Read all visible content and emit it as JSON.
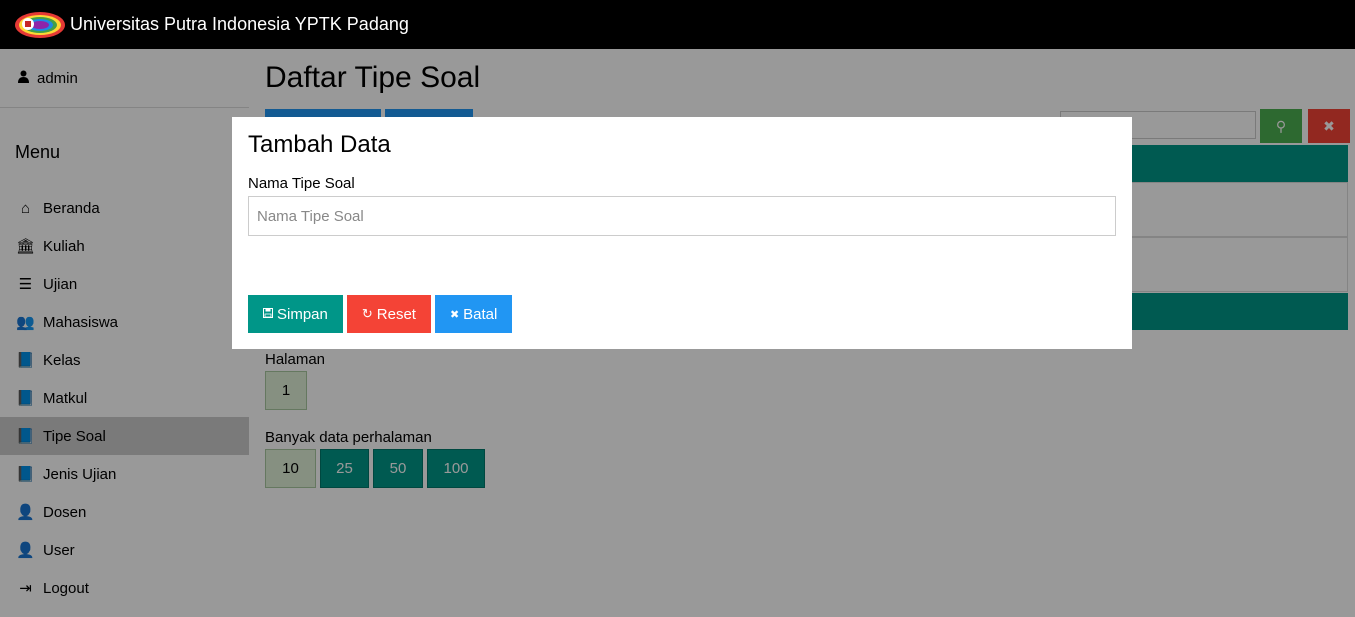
{
  "header": {
    "brand": "Universitas Putra Indonesia YPTK Padang"
  },
  "sidebar": {
    "user": "admin",
    "menu_title": "Menu",
    "items": [
      {
        "label": "Beranda",
        "icon": "home-icon",
        "glyph": "⌂"
      },
      {
        "label": "Kuliah",
        "icon": "institution-icon",
        "glyph": "🏛"
      },
      {
        "label": "Ujian",
        "icon": "list-alt-icon",
        "glyph": "☰"
      },
      {
        "label": "Mahasiswa",
        "icon": "users-icon",
        "glyph": "👥"
      },
      {
        "label": "Kelas",
        "icon": "book-icon",
        "glyph": "📘"
      },
      {
        "label": "Matkul",
        "icon": "book-icon",
        "glyph": "📘"
      },
      {
        "label": "Tipe Soal",
        "icon": "book-icon",
        "glyph": "📘"
      },
      {
        "label": "Jenis Ujian",
        "icon": "book-icon",
        "glyph": "📘"
      },
      {
        "label": "Dosen",
        "icon": "user-secret-icon",
        "glyph": "👤"
      },
      {
        "label": "User",
        "icon": "user-secret-icon",
        "glyph": "👤"
      },
      {
        "label": "Logout",
        "icon": "sign-out-icon",
        "glyph": "⇥"
      }
    ],
    "active_index": 6
  },
  "main": {
    "title": "Daftar Tipe Soal",
    "halaman_label": "Halaman",
    "page_current": "1",
    "perpage_label": "Banyak data perhalaman",
    "perpage_options": [
      "10",
      "25",
      "50",
      "100"
    ],
    "perpage_selected": "10"
  },
  "modal": {
    "title": "Tambah Data",
    "field_label": "Nama Tipe Soal",
    "field_placeholder": "Nama Tipe Soal",
    "field_value": "",
    "buttons": {
      "save": "Simpan",
      "reset": "Reset",
      "cancel": "Batal"
    }
  },
  "colors": {
    "teal": "#009688",
    "red": "#f44336",
    "blue": "#2196F3",
    "green": "#4CAF50"
  }
}
